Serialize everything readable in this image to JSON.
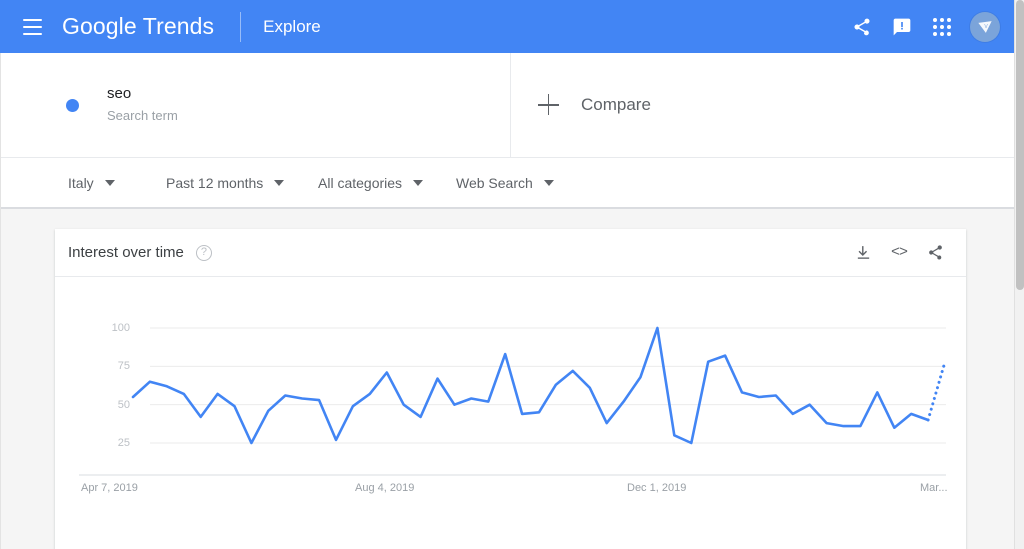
{
  "header": {
    "menu_icon": "hamburger-menu-icon",
    "brand_google": "Google",
    "brand_trends": "Trends",
    "explore_label": "Explore",
    "share_icon": "share-icon",
    "feedback_icon": "feedback-icon",
    "apps_icon": "apps-grid-icon",
    "avatar_icon": "user-avatar",
    "background_color": "#4285f4"
  },
  "search_terms": {
    "dot_color": "#4285f4",
    "term": "seo",
    "term_type": "Search term",
    "compare_label": "Compare",
    "compare_icon": "plus-icon"
  },
  "filters": [
    {
      "label": "Italy",
      "icon": "chevron-down-icon"
    },
    {
      "label": "Past 12 months",
      "icon": "chevron-down-icon"
    },
    {
      "label": "All categories",
      "icon": "chevron-down-icon"
    },
    {
      "label": "Web Search",
      "icon": "chevron-down-icon"
    }
  ],
  "card": {
    "title": "Interest over time",
    "help_icon": "help-circle-icon",
    "help_glyph": "?",
    "download_icon": "download-icon",
    "embed_icon": "embed-code-icon",
    "embed_glyph": "<>",
    "share_icon": "share-icon"
  },
  "chart_data": {
    "type": "line",
    "title": "Interest over time",
    "xlabel": "",
    "ylabel": "",
    "ylim": [
      0,
      100
    ],
    "yticks": [
      25,
      50,
      75,
      100
    ],
    "grid": true,
    "legend": false,
    "line_color": "#4285f4",
    "series_name": "seo",
    "xtick_labels": [
      "Apr 7, 2019",
      "Aug 4, 2019",
      "Dec 1, 2019",
      "Mar..."
    ],
    "xtick_positions": [
      0,
      17,
      34,
      52
    ],
    "partial_last_segment": true,
    "values": [
      55,
      65,
      62,
      57,
      42,
      57,
      49,
      25,
      46,
      56,
      54,
      53,
      27,
      49,
      57,
      71,
      50,
      42,
      67,
      50,
      54,
      52,
      83,
      44,
      45,
      63,
      72,
      61,
      38,
      52,
      68,
      100,
      30,
      25,
      78,
      82,
      58,
      55,
      56,
      44,
      50,
      38,
      36,
      36,
      58,
      35,
      44,
      40,
      78
    ]
  },
  "scrollbar": {
    "name": "page-scrollbar"
  }
}
